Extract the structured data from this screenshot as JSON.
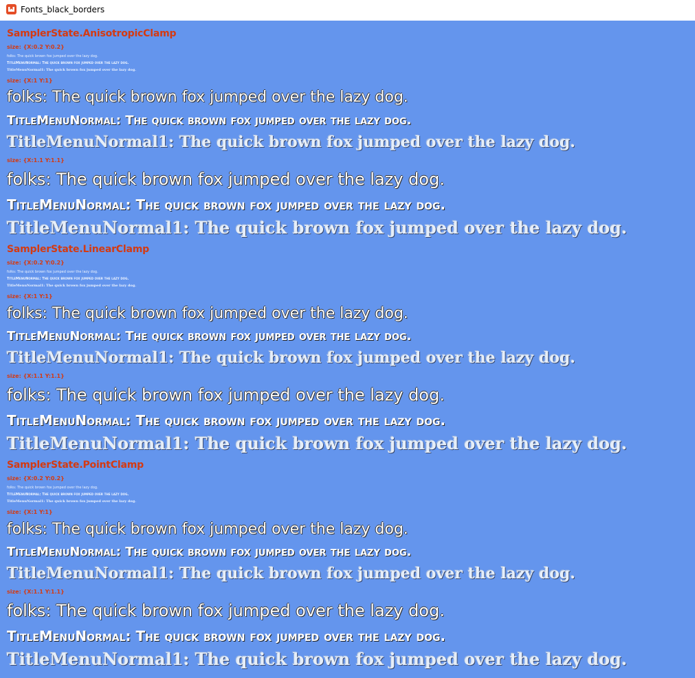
{
  "window": {
    "title": "Fonts_black_borders",
    "accent": "#E44D26"
  },
  "canvas": {
    "background": "#6495ED",
    "label_color": "#D43A12",
    "sections": [
      {
        "sampler": "SamplerState.AnisotropicClamp",
        "sizes": [
          {
            "label": "size: {X:0.2 Y:0.2}"
          },
          {
            "label": "size: {X:1 Y:1}"
          },
          {
            "label": "size: {X:1.1 Y:1.1}"
          }
        ]
      },
      {
        "sampler": "SamplerState.LinearClamp",
        "sizes": [
          {
            "label": "size: {X:0.2 Y:0.2}"
          },
          {
            "label": "size: {X:1 Y:1}"
          },
          {
            "label": "size: {X:1.1 Y:1.1}"
          }
        ]
      },
      {
        "sampler": "SamplerState.PointClamp",
        "sizes": [
          {
            "label": "size: {X:0.2 Y:0.2}"
          },
          {
            "label": "size: {X:1 Y:1}"
          },
          {
            "label": "size: {X:1.1 Y:1.1}"
          }
        ]
      }
    ],
    "sample_lines": {
      "folks": "folks: The quick brown fox jumped over the lazy dog.",
      "title_menu_normal": "TitleMenuNormal: The quick brown fox jumped over the lazy dog.",
      "title_menu_normal1": "TitleMenuNormal1: The quick brown fox jumped over the lazy dog."
    }
  }
}
